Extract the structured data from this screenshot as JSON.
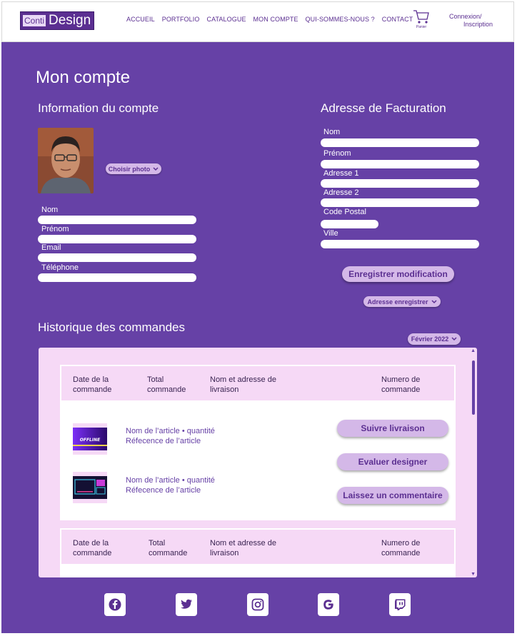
{
  "header": {
    "logo_small": "Conti",
    "logo_big": "Design",
    "nav": [
      "ACCUEIL",
      "PORTFOLIO",
      "CATALOGUE",
      "MON COMPTE",
      "QUI-SOMMES-NOUS ?",
      "CONTACT"
    ],
    "cart_label": "Panier",
    "login_line1": "Connexion/",
    "login_line2": "Inscription"
  },
  "page": {
    "title": "Mon compte"
  },
  "account": {
    "title": "Information du compte",
    "photo_button": "Choisir photo",
    "fields": [
      "Nom",
      "Prénom",
      "Email",
      "Téléphone"
    ]
  },
  "billing": {
    "title": "Adresse de Facturation",
    "fields": [
      "Nom",
      "Prénom",
      "Adresse 1",
      "Adresse 2",
      "Code Postal",
      "Ville"
    ],
    "save_button": "Enregistrer modification",
    "saved_address": "Adresse enregistrer"
  },
  "orders": {
    "title": "Historique des commandes",
    "month_filter": "Février 2022",
    "columns": [
      "Date de la commande",
      "Total commande",
      "Nom et adresse de livraison",
      "Numero de commande"
    ],
    "col_date_l1": "Date de la",
    "col_date_l2": "commande",
    "col_total_l1": "Total",
    "col_total_l2": "commande",
    "col_addr_l1": "Nom et adresse de",
    "col_addr_l2": "livraison",
    "col_num_l1": "Numero de",
    "col_num_l2": "commande",
    "items": [
      {
        "name": "Nom de l’article • quantité",
        "ref": "Réfecence de l’article",
        "thumb_text": "OFFLINE"
      },
      {
        "name": "Nom de l’article • quantité",
        "ref": "Réfecence de l’article",
        "thumb_text": ""
      }
    ],
    "actions": [
      "Suivre livraison",
      "Evaluer designer",
      "Laissez un commentaire"
    ]
  },
  "footer": {
    "social": [
      "facebook-icon",
      "twitter-icon",
      "instagram-icon",
      "google-icon",
      "twitch-icon"
    ]
  },
  "colors": {
    "brand_purple": "#6641a6",
    "pill": "#d4b8e8",
    "panel_pink": "#f6d9f6"
  }
}
